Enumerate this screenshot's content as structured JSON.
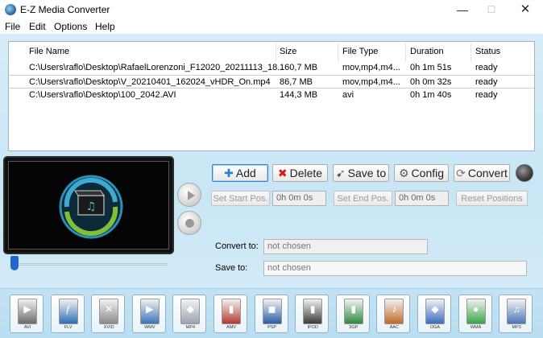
{
  "app": {
    "title": "E-Z Media Converter"
  },
  "window_buttons": {
    "minimize": "—",
    "maximize": "☐",
    "close": "✕"
  },
  "menu": [
    "File",
    "Edit",
    "Options",
    "Help"
  ],
  "table": {
    "columns": [
      "File Name",
      "Size",
      "File Type",
      "Duration",
      "Status"
    ],
    "rows": [
      [
        "C:\\Users\\raflo\\Desktop\\RafaelLorenzoni_F12020_20211113_18...",
        "160,7 MB",
        "mov,mp4,m4...",
        "0h 1m 51s",
        "ready"
      ],
      [
        "C:\\Users\\raflo\\Desktop\\V_20210401_162024_vHDR_On.mp4",
        "86,7 MB",
        "mov,mp4,m4...",
        "0h 0m 32s",
        "ready"
      ],
      [
        "C:\\Users\\raflo\\Desktop\\100_2042.AVI",
        "144,3 MB",
        "avi",
        "0h 1m 40s",
        "ready"
      ]
    ]
  },
  "toolbar": {
    "add": "Add",
    "delete": "Delete",
    "save_to": "Save to",
    "config": "Config",
    "convert": "Convert"
  },
  "positions": {
    "set_start": "Set Start Pos.",
    "start_value": "0h 0m 0s",
    "set_end": "Set End Pos.",
    "end_value": "0h 0m 0s",
    "reset": "Reset Positions"
  },
  "convert_to": {
    "label": "Convert to:",
    "value": "not chosen"
  },
  "save_to": {
    "label": "Save to:",
    "value": "not chosen"
  },
  "player": {
    "seek_fraction": 0
  },
  "formats": [
    {
      "label": "AVI",
      "color": "#6b6b6b"
    },
    {
      "label": "FLV",
      "color": "#2f6fb5"
    },
    {
      "label": "XVID",
      "color": "#8a8a8a"
    },
    {
      "label": "WMV",
      "color": "#3c76b6"
    },
    {
      "label": "MP4",
      "color": "#9aa3ad"
    },
    {
      "label": "AMV",
      "color": "#b23a2f"
    },
    {
      "label": "PSP",
      "color": "#2a5fa6"
    },
    {
      "label": "IPOD",
      "color": "#3b3b3b"
    },
    {
      "label": "3GP",
      "color": "#2d8a3d"
    },
    {
      "label": "AAC",
      "color": "#c26a2a"
    },
    {
      "label": "OGA",
      "color": "#3d6cc2"
    },
    {
      "label": "WMA",
      "color": "#3aa54a"
    },
    {
      "label": "MP3",
      "color": "#4b77b8"
    }
  ]
}
